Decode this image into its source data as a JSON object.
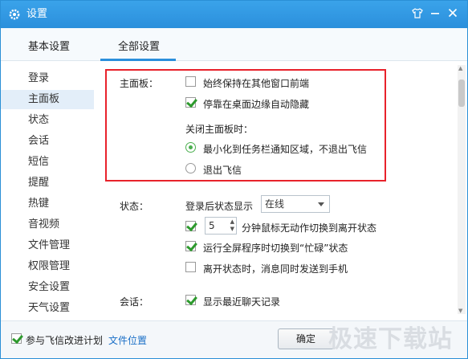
{
  "window": {
    "title": "设置"
  },
  "tabs": [
    {
      "label": "基本设置"
    },
    {
      "label": "全部设置"
    }
  ],
  "sidebar": {
    "items": [
      {
        "label": "登录"
      },
      {
        "label": "主面板"
      },
      {
        "label": "状态"
      },
      {
        "label": "会话"
      },
      {
        "label": "短信"
      },
      {
        "label": "提醒"
      },
      {
        "label": "热键"
      },
      {
        "label": "音视频"
      },
      {
        "label": "文件管理"
      },
      {
        "label": "权限管理"
      },
      {
        "label": "安全设置"
      },
      {
        "label": "天气设置"
      }
    ]
  },
  "main_panel": {
    "label": "主面板：",
    "always_top": "始终保持在其他窗口前端",
    "auto_hide": "停靠在桌面边缘自动隐藏",
    "close_label": "关闭主面板时：",
    "minimize_tray": "最小化到任务栏通知区域，不退出飞信",
    "exit": "退出飞信"
  },
  "status": {
    "label": "状态：",
    "after_login": "登录后状态显示",
    "select_value": "在线",
    "idle_minutes": "5",
    "idle_text": "分钟鼠标无动作切换到离开状态",
    "fullscreen": "运行全屏程序时切换到“忙碌”状态",
    "away_sms": "离开状态时，消息同时发送到手机"
  },
  "session": {
    "label": "会话：",
    "show_recent": "显示最近聊天记录"
  },
  "footer": {
    "improve": "参与飞信改进计划",
    "file_location": "文件位置",
    "ok": "确定"
  },
  "watermark": "极速下载站"
}
